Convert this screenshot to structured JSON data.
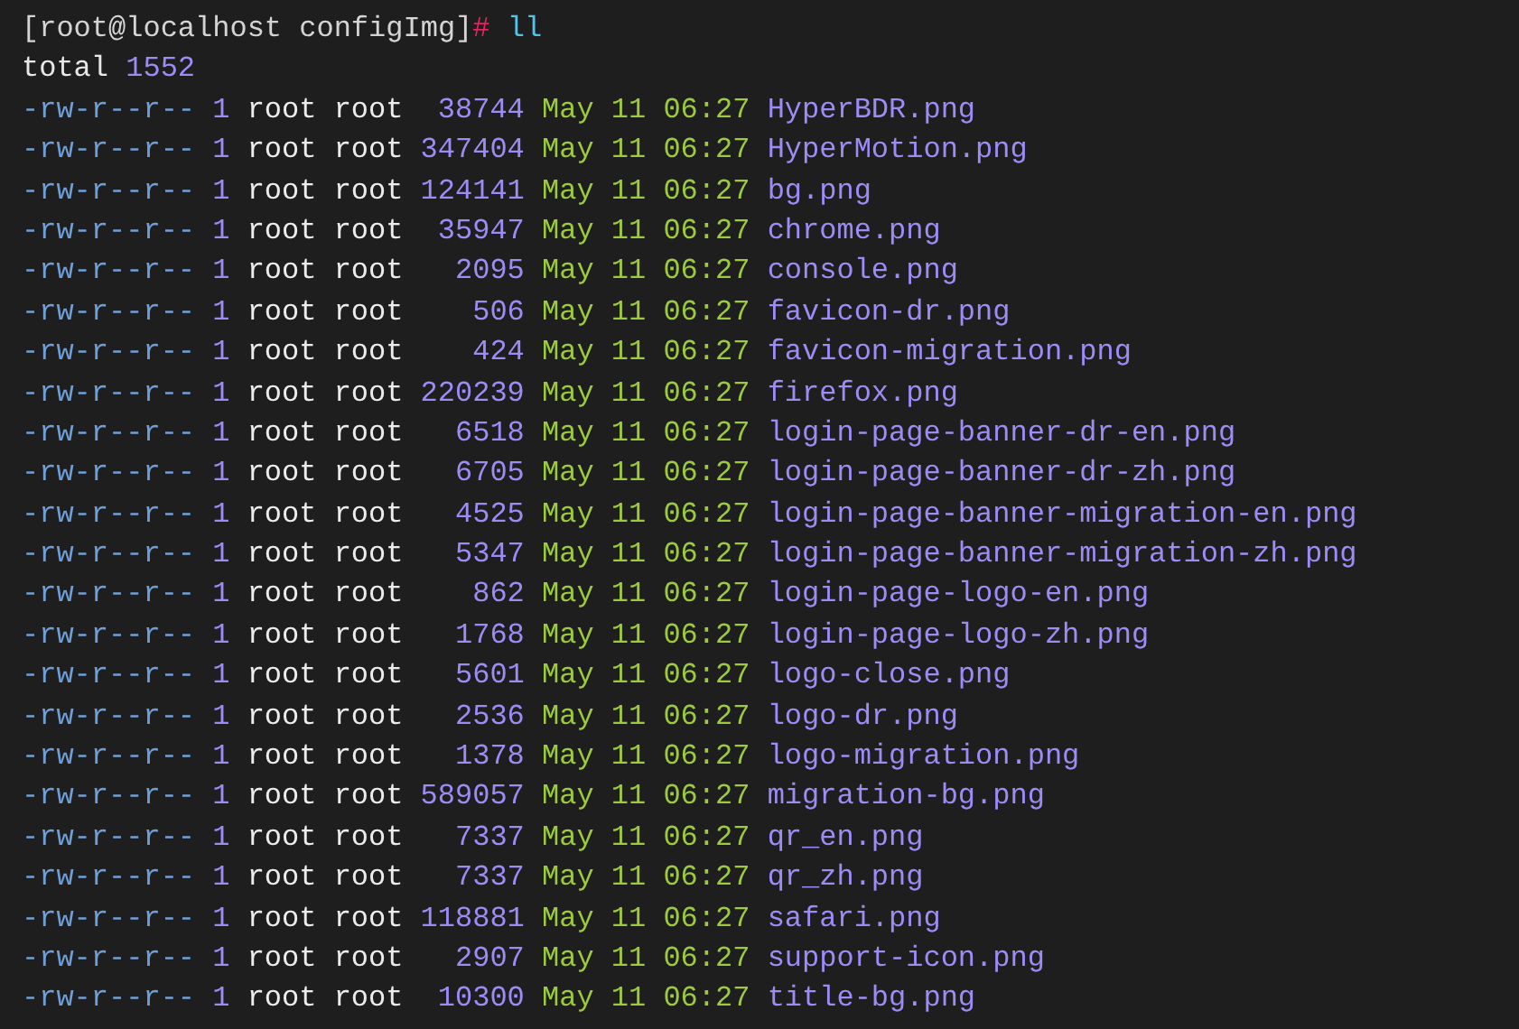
{
  "prompt": {
    "user_host": "[root@localhost configImg]",
    "symbol": "#",
    "command": "ll"
  },
  "total": {
    "label": "total",
    "value": "1552"
  },
  "files": [
    {
      "perms": "-rw-r--r--",
      "links": "1",
      "owner": "root",
      "group": "root",
      "size": "38744",
      "month": "May",
      "day": "11",
      "time": "06:27",
      "name": "HyperBDR.png"
    },
    {
      "perms": "-rw-r--r--",
      "links": "1",
      "owner": "root",
      "group": "root",
      "size": "347404",
      "month": "May",
      "day": "11",
      "time": "06:27",
      "name": "HyperMotion.png"
    },
    {
      "perms": "-rw-r--r--",
      "links": "1",
      "owner": "root",
      "group": "root",
      "size": "124141",
      "month": "May",
      "day": "11",
      "time": "06:27",
      "name": "bg.png"
    },
    {
      "perms": "-rw-r--r--",
      "links": "1",
      "owner": "root",
      "group": "root",
      "size": "35947",
      "month": "May",
      "day": "11",
      "time": "06:27",
      "name": "chrome.png"
    },
    {
      "perms": "-rw-r--r--",
      "links": "1",
      "owner": "root",
      "group": "root",
      "size": "2095",
      "month": "May",
      "day": "11",
      "time": "06:27",
      "name": "console.png"
    },
    {
      "perms": "-rw-r--r--",
      "links": "1",
      "owner": "root",
      "group": "root",
      "size": "506",
      "month": "May",
      "day": "11",
      "time": "06:27",
      "name": "favicon-dr.png"
    },
    {
      "perms": "-rw-r--r--",
      "links": "1",
      "owner": "root",
      "group": "root",
      "size": "424",
      "month": "May",
      "day": "11",
      "time": "06:27",
      "name": "favicon-migration.png"
    },
    {
      "perms": "-rw-r--r--",
      "links": "1",
      "owner": "root",
      "group": "root",
      "size": "220239",
      "month": "May",
      "day": "11",
      "time": "06:27",
      "name": "firefox.png"
    },
    {
      "perms": "-rw-r--r--",
      "links": "1",
      "owner": "root",
      "group": "root",
      "size": "6518",
      "month": "May",
      "day": "11",
      "time": "06:27",
      "name": "login-page-banner-dr-en.png"
    },
    {
      "perms": "-rw-r--r--",
      "links": "1",
      "owner": "root",
      "group": "root",
      "size": "6705",
      "month": "May",
      "day": "11",
      "time": "06:27",
      "name": "login-page-banner-dr-zh.png"
    },
    {
      "perms": "-rw-r--r--",
      "links": "1",
      "owner": "root",
      "group": "root",
      "size": "4525",
      "month": "May",
      "day": "11",
      "time": "06:27",
      "name": "login-page-banner-migration-en.png"
    },
    {
      "perms": "-rw-r--r--",
      "links": "1",
      "owner": "root",
      "group": "root",
      "size": "5347",
      "month": "May",
      "day": "11",
      "time": "06:27",
      "name": "login-page-banner-migration-zh.png"
    },
    {
      "perms": "-rw-r--r--",
      "links": "1",
      "owner": "root",
      "group": "root",
      "size": "862",
      "month": "May",
      "day": "11",
      "time": "06:27",
      "name": "login-page-logo-en.png"
    },
    {
      "perms": "-rw-r--r--",
      "links": "1",
      "owner": "root",
      "group": "root",
      "size": "1768",
      "month": "May",
      "day": "11",
      "time": "06:27",
      "name": "login-page-logo-zh.png"
    },
    {
      "perms": "-rw-r--r--",
      "links": "1",
      "owner": "root",
      "group": "root",
      "size": "5601",
      "month": "May",
      "day": "11",
      "time": "06:27",
      "name": "logo-close.png"
    },
    {
      "perms": "-rw-r--r--",
      "links": "1",
      "owner": "root",
      "group": "root",
      "size": "2536",
      "month": "May",
      "day": "11",
      "time": "06:27",
      "name": "logo-dr.png"
    },
    {
      "perms": "-rw-r--r--",
      "links": "1",
      "owner": "root",
      "group": "root",
      "size": "1378",
      "month": "May",
      "day": "11",
      "time": "06:27",
      "name": "logo-migration.png"
    },
    {
      "perms": "-rw-r--r--",
      "links": "1",
      "owner": "root",
      "group": "root",
      "size": "589057",
      "month": "May",
      "day": "11",
      "time": "06:27",
      "name": "migration-bg.png"
    },
    {
      "perms": "-rw-r--r--",
      "links": "1",
      "owner": "root",
      "group": "root",
      "size": "7337",
      "month": "May",
      "day": "11",
      "time": "06:27",
      "name": "qr_en.png"
    },
    {
      "perms": "-rw-r--r--",
      "links": "1",
      "owner": "root",
      "group": "root",
      "size": "7337",
      "month": "May",
      "day": "11",
      "time": "06:27",
      "name": "qr_zh.png"
    },
    {
      "perms": "-rw-r--r--",
      "links": "1",
      "owner": "root",
      "group": "root",
      "size": "118881",
      "month": "May",
      "day": "11",
      "time": "06:27",
      "name": "safari.png"
    },
    {
      "perms": "-rw-r--r--",
      "links": "1",
      "owner": "root",
      "group": "root",
      "size": "2907",
      "month": "May",
      "day": "11",
      "time": "06:27",
      "name": "support-icon.png"
    },
    {
      "perms": "-rw-r--r--",
      "links": "1",
      "owner": "root",
      "group": "root",
      "size": "10300",
      "month": "May",
      "day": "11",
      "time": "06:27",
      "name": "title-bg.png"
    }
  ]
}
